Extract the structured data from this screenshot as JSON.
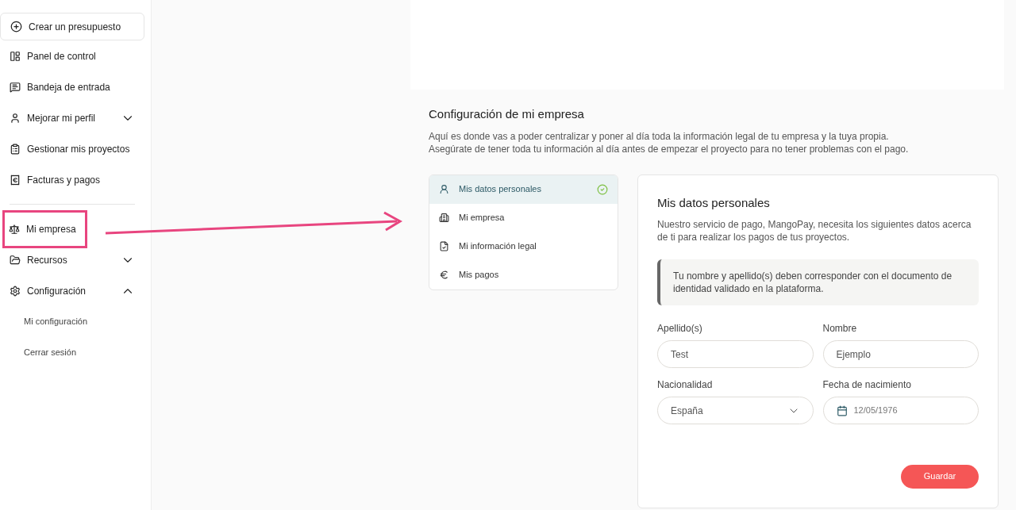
{
  "sidebar": {
    "create_button": "Crear un presupuesto",
    "items": [
      {
        "label": "Panel de control"
      },
      {
        "label": "Bandeja de entrada"
      },
      {
        "label": "Mejorar mi perfil",
        "expanded": false
      },
      {
        "label": "Gestionar mis proyectos"
      },
      {
        "label": "Facturas y pagos",
        "divider_after": true
      },
      {
        "label": "Mi empresa",
        "annotated": true
      },
      {
        "label": "Recursos",
        "expanded": false
      },
      {
        "label": "Configuración",
        "expanded": true,
        "children": [
          {
            "label": "Mi configuración"
          },
          {
            "label": "Cerrar sesión"
          }
        ]
      }
    ]
  },
  "page": {
    "title": "Configuración de mi empresa",
    "description": [
      "Aquí es donde vas a poder centralizar y poner al día toda la información legal de tu empresa y la tuya propia.",
      "Asegúrate de tener toda tu información al día antes de empezar el proyecto para no tener problemas con el pago."
    ]
  },
  "steps": [
    {
      "label": "Mis datos personales",
      "selected": true,
      "done": true
    },
    {
      "label": "Mi empresa",
      "selected": false,
      "done": false
    },
    {
      "label": "Mi información legal",
      "selected": false,
      "done": false
    },
    {
      "label": "Mis pagos",
      "selected": false,
      "done": false
    }
  ],
  "form": {
    "title": "Mis datos personales",
    "description": "Nuestro servicio de pago, MangoPay, necesita los siguientes datos acerca de ti para realizar los pagos de tus proyectos.",
    "notice": "Tu nombre y apellido(s) deben corresponder con el documento de identidad validado en la plataforma.",
    "fields": [
      {
        "kind": "text",
        "label": "Apellido(s)",
        "value": "Test"
      },
      {
        "kind": "text",
        "label": "Nombre",
        "value": "Ejemplo"
      },
      {
        "kind": "select",
        "label": "Nacionalidad",
        "value": "España"
      },
      {
        "kind": "date",
        "label": "Fecha de nacimiento",
        "value": "12/05/1976"
      }
    ],
    "save_button": "Guardar"
  }
}
